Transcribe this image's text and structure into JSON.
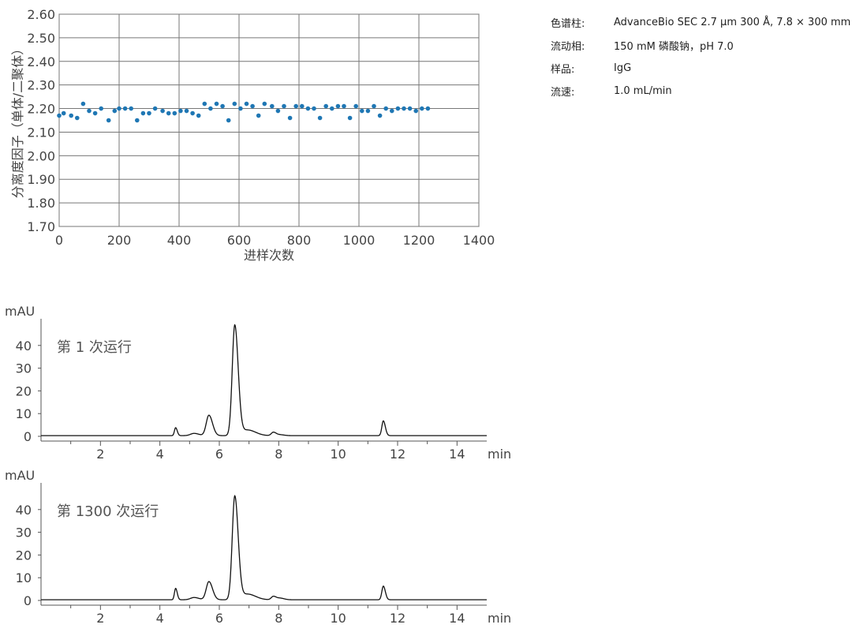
{
  "conditions": [
    {
      "label": "色谱柱:",
      "value": "AdvanceBio SEC 2.7 µm 300 Å, 7.8 × 300 mm"
    },
    {
      "label": "流动相:",
      "value": "150 mM 磷酸钠，pH 7.0"
    },
    {
      "label": "样品:",
      "value": "IgG"
    },
    {
      "label": "流速:",
      "value": "1.0 mL/min"
    }
  ],
  "chart_data": [
    {
      "type": "scatter",
      "xlabel": "进样次数",
      "ylabel": "分离度因子（单体/二聚体）",
      "xlim": [
        0,
        1400
      ],
      "ylim": [
        1.7,
        2.6
      ],
      "xticks": [
        "0",
        "200",
        "400",
        "600",
        "800",
        "1000",
        "1200",
        "1400"
      ],
      "yticks": [
        "1.70",
        "1.80",
        "1.90",
        "2.00",
        "2.10",
        "2.20",
        "2.30",
        "2.40",
        "2.50",
        "2.60"
      ],
      "grid": true,
      "color": "#1f77b4",
      "series": [
        {
          "x": [
            0,
            15,
            40,
            60,
            80,
            100,
            120,
            140,
            165,
            185,
            200,
            220,
            240,
            260,
            280,
            300,
            320,
            345,
            365,
            385,
            405,
            425,
            445,
            465,
            485,
            505,
            525,
            545,
            565,
            585,
            605,
            625,
            645,
            665,
            685,
            710,
            730,
            750,
            770,
            790,
            810,
            830,
            850,
            870,
            890,
            910,
            930,
            950,
            970,
            990,
            1010,
            1030,
            1050,
            1070,
            1090,
            1110,
            1130,
            1150,
            1170,
            1190,
            1210,
            1230
          ],
          "y": [
            2.17,
            2.18,
            2.17,
            2.16,
            2.22,
            2.19,
            2.18,
            2.2,
            2.15,
            2.19,
            2.2,
            2.2,
            2.2,
            2.15,
            2.18,
            2.18,
            2.2,
            2.19,
            2.18,
            2.18,
            2.19,
            2.19,
            2.18,
            2.17,
            2.22,
            2.2,
            2.22,
            2.21,
            2.15,
            2.22,
            2.2,
            2.22,
            2.21,
            2.17,
            2.22,
            2.21,
            2.19,
            2.21,
            2.16,
            2.21,
            2.21,
            2.2,
            2.2,
            2.16,
            2.21,
            2.2,
            2.21,
            2.21,
            2.16,
            2.21,
            2.19,
            2.19,
            2.21,
            2.17,
            2.2,
            2.19,
            2.2,
            2.2,
            2.2,
            2.19,
            2.2,
            2.2
          ]
        }
      ]
    },
    {
      "type": "line",
      "annotation": "第 1 次运行",
      "ylabel": "mAU",
      "xunit": "min",
      "xlim": [
        0,
        15
      ],
      "ylim": [
        -2,
        50
      ],
      "xticks": [
        2,
        4,
        6,
        8,
        10,
        12,
        14
      ],
      "yticks": [
        0,
        10,
        20,
        30,
        40
      ],
      "baseline": 0.3,
      "peaks": [
        {
          "t": 4.53,
          "h": 3.5,
          "w": 0.04
        },
        {
          "t": 5.15,
          "h": 1.0,
          "w": 0.12
        },
        {
          "t": 5.65,
          "h": 9.0,
          "w": 0.09
        },
        {
          "t": 6.52,
          "h": 48.5,
          "w": 0.085
        },
        {
          "t": 6.95,
          "h": 2.5,
          "w": 0.2
        },
        {
          "t": 7.82,
          "h": 1.5,
          "w": 0.07
        },
        {
          "t": 8.05,
          "h": 0.4,
          "w": 0.1
        },
        {
          "t": 11.52,
          "h": 6.5,
          "w": 0.05
        }
      ]
    },
    {
      "type": "line",
      "annotation": "第 1300 次运行",
      "ylabel": "mAU",
      "xunit": "min",
      "xlim": [
        0,
        15
      ],
      "ylim": [
        -2,
        50
      ],
      "xticks": [
        2,
        4,
        6,
        8,
        10,
        12,
        14
      ],
      "yticks": [
        0,
        10,
        20,
        30,
        40
      ],
      "baseline": 0.3,
      "peaks": [
        {
          "t": 4.53,
          "h": 5.0,
          "w": 0.04
        },
        {
          "t": 5.15,
          "h": 1.0,
          "w": 0.12
        },
        {
          "t": 5.65,
          "h": 8.0,
          "w": 0.09
        },
        {
          "t": 6.52,
          "h": 45.5,
          "w": 0.085
        },
        {
          "t": 6.95,
          "h": 2.5,
          "w": 0.2
        },
        {
          "t": 7.82,
          "h": 1.5,
          "w": 0.07
        },
        {
          "t": 8.05,
          "h": 0.7,
          "w": 0.1
        },
        {
          "t": 11.52,
          "h": 6.0,
          "w": 0.05
        }
      ]
    }
  ]
}
